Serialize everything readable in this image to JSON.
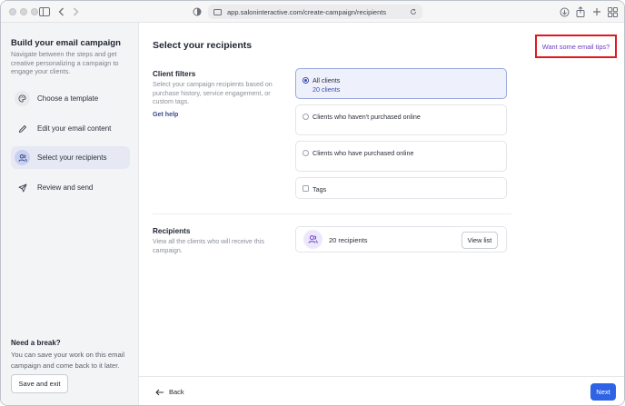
{
  "browser": {
    "url": "app.saloninteractive.com/create-campaign/recipients"
  },
  "sidebar": {
    "title": "Build your email campaign",
    "description": "Navigate between the steps and get creative personalizing a campaign to engage your clients.",
    "steps": [
      {
        "label": "Choose a template",
        "icon": "palette-icon",
        "active": false
      },
      {
        "label": "Edit your email content",
        "icon": "pencil-icon",
        "active": false
      },
      {
        "label": "Select your recipients",
        "icon": "users-icon",
        "active": true
      },
      {
        "label": "Review and send",
        "icon": "send-icon",
        "active": false
      }
    ],
    "break_title": "Need a break?",
    "break_desc": "You can save your work on this email campaign and come back to it later.",
    "save_exit_label": "Save and exit"
  },
  "main": {
    "title": "Select your recipients",
    "tips_link": "Want some email tips?",
    "client_filters": {
      "title": "Client filters",
      "description": "Select your campaign recipients based on purchase history, service engagement, or custom tags.",
      "help_link": "Get help",
      "options": [
        {
          "label": "All clients",
          "sub": "20 clients",
          "selected": true,
          "kind": "radio"
        },
        {
          "label": "Clients who haven't purchased online",
          "selected": false,
          "kind": "radio"
        },
        {
          "label": "Clients who have purchased online",
          "selected": false,
          "kind": "radio"
        },
        {
          "label": "Tags",
          "selected": false,
          "kind": "checkbox"
        }
      ]
    },
    "recipients": {
      "title": "Recipients",
      "description": "View all the clients who will receive this campaign.",
      "count_label": "20 recipients",
      "view_list_label": "View list"
    }
  },
  "footer": {
    "back_label": "Back",
    "next_label": "Next"
  },
  "colors": {
    "accent": "#2f63e6",
    "highlight_box": "#e0181f",
    "link_purple": "#6a3fc6"
  }
}
